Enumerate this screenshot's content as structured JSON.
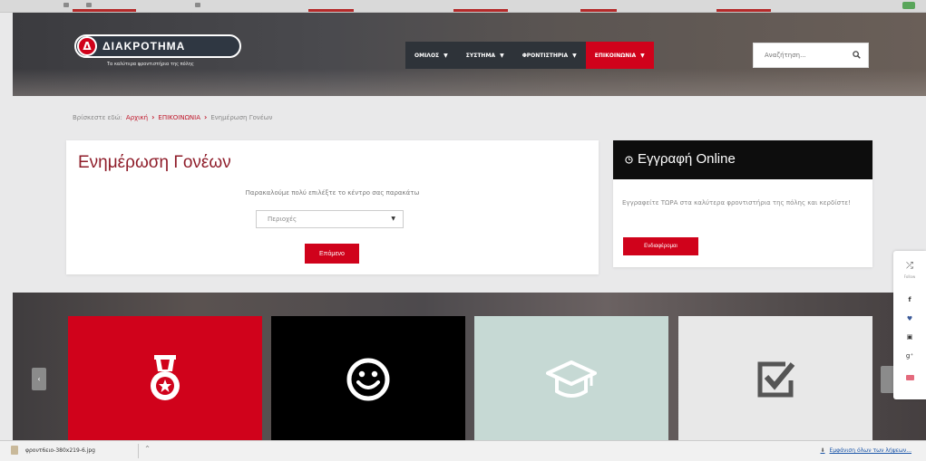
{
  "site": {
    "logo_text": "ΔΙΑΚΡΟΤΗΜΑ",
    "logo_letter": "Δ",
    "tagline": "Τα καλύτερα φροντιστήρια της πόλης"
  },
  "nav": {
    "items": [
      {
        "label": "ΟΜΙΛΟΣ",
        "active": false
      },
      {
        "label": "ΣΥΣΤΗΜΑ",
        "active": false
      },
      {
        "label": "ΦΡΟΝΤΙΣΤΗΡΙΑ",
        "active": false
      },
      {
        "label": "ΕΠΙΚΟΙΝΩΝΙΑ",
        "active": true
      }
    ],
    "search_placeholder": "Αναζήτηση..."
  },
  "breadcrumb": {
    "prefix": "Βρίσκεστε εδώ:",
    "home": "Αρχική",
    "section": "ΕΠΙΚΟΙΝΩΝΙΑ",
    "current": "Ενημέρωση Γονέων"
  },
  "parents_form": {
    "title": "Ενημέρωση Γονέων",
    "instruction": "Παρακαλούμε πολύ επιλέξτε το κέντρο σας παρακάτω",
    "select_value": "Περιοχές",
    "next_label": "Επόμενο"
  },
  "register": {
    "title": "Εγγραφή Online",
    "text": "Εγγραφείτε ΤΩΡΑ στα καλύτερα φροντιστήρια της πόλης και κερδίστε!",
    "button_label": "Ενδιαφέρομαι"
  },
  "tiles": [
    {
      "icon": "medal-icon",
      "color": "#d0021b"
    },
    {
      "icon": "smiley-icon",
      "color": "#000000"
    },
    {
      "icon": "graduation-cap-icon",
      "color": "#c6d9d4"
    },
    {
      "icon": "checkbox-icon",
      "color": "#e8e8e8"
    }
  ],
  "social": {
    "follow_label": "Follow",
    "items": [
      "facebook-icon",
      "twitter-icon",
      "youtube-icon",
      "google-plus-icon",
      "mail-icon"
    ]
  },
  "downloads": {
    "file_name": "φροντ6ειο-380x219-6.jpg",
    "show_all": "Εμφάνιση όλων των λήψεων..."
  },
  "colors": {
    "accent": "#d0021b",
    "title": "#8f1d2a",
    "nav_dark": "#2e3339"
  }
}
